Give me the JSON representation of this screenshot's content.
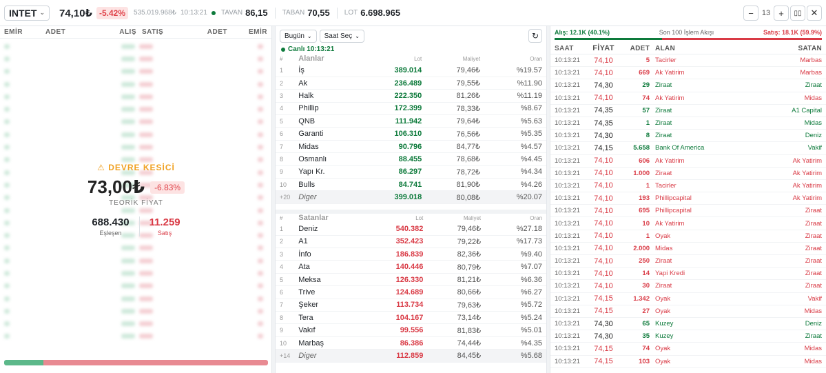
{
  "header": {
    "symbol": "INTET",
    "price": "74,10₺",
    "change": "-5.42%",
    "volume": "535.019.968₺",
    "time": "10:13:21",
    "tavan_label": "TAVAN",
    "tavan": "86,15",
    "taban_label": "TABAN",
    "taban": "70,55",
    "lot_label": "LOT",
    "lot": "6.698.965",
    "zoom": "13"
  },
  "orderbook": {
    "col_emir": "EMİR",
    "col_adet": "ADET",
    "col_alis": "ALIŞ",
    "col_satis": "SATIŞ",
    "col_adet2": "ADET",
    "col_emir2": "EMİR",
    "circuit_title": "DEVRE KESİCİ",
    "theoretical_price": "73,00₺",
    "theoretical_change": "-6.83%",
    "theoretical_label": "TEORİK FİYAT",
    "matched": "688.430",
    "matched_label": "Eşleşen",
    "sell": "11.259",
    "sell_label": "Satış",
    "colors": {
      "buy": "#0d7a3b",
      "sell": "#d93a45"
    }
  },
  "brokers": {
    "filter_day": "Bugün",
    "filter_time": "Saat Seç",
    "live": "Canlı 10:13:21",
    "col_lot": "Lot",
    "col_cost": "Maliyet",
    "col_ratio": "Oran",
    "buyers_title": "Alanlar",
    "buyers": [
      {
        "i": "1",
        "name": "İş",
        "lot": "389.014",
        "cost": "79,46₺",
        "ratio": "%19.57"
      },
      {
        "i": "2",
        "name": "Ak",
        "lot": "236.489",
        "cost": "79,55₺",
        "ratio": "%11.90"
      },
      {
        "i": "3",
        "name": "Halk",
        "lot": "222.350",
        "cost": "81,26₺",
        "ratio": "%11.19"
      },
      {
        "i": "4",
        "name": "Phillip",
        "lot": "172.399",
        "cost": "78,33₺",
        "ratio": "%8.67"
      },
      {
        "i": "5",
        "name": "QNB",
        "lot": "111.942",
        "cost": "79,64₺",
        "ratio": "%5.63"
      },
      {
        "i": "6",
        "name": "Garanti",
        "lot": "106.310",
        "cost": "76,56₺",
        "ratio": "%5.35"
      },
      {
        "i": "7",
        "name": "Midas",
        "lot": "90.796",
        "cost": "84,77₺",
        "ratio": "%4.57"
      },
      {
        "i": "8",
        "name": "Osmanlı",
        "lot": "88.455",
        "cost": "78,68₺",
        "ratio": "%4.45"
      },
      {
        "i": "9",
        "name": "Yapı Kr.",
        "lot": "86.297",
        "cost": "78,72₺",
        "ratio": "%4.34"
      },
      {
        "i": "10",
        "name": "Bulls",
        "lot": "84.741",
        "cost": "81,90₺",
        "ratio": "%4.26"
      }
    ],
    "buyers_other": {
      "i": "+20",
      "name": "Diger",
      "lot": "399.018",
      "cost": "80,08₺",
      "ratio": "%20.07"
    },
    "sellers_title": "Satanlar",
    "sellers": [
      {
        "i": "1",
        "name": "Deniz",
        "lot": "540.382",
        "cost": "79,46₺",
        "ratio": "%27.18"
      },
      {
        "i": "2",
        "name": "A1",
        "lot": "352.423",
        "cost": "79,22₺",
        "ratio": "%17.73"
      },
      {
        "i": "3",
        "name": "İnfo",
        "lot": "186.839",
        "cost": "82,36₺",
        "ratio": "%9.40"
      },
      {
        "i": "4",
        "name": "Ata",
        "lot": "140.446",
        "cost": "80,79₺",
        "ratio": "%7.07"
      },
      {
        "i": "5",
        "name": "Meksa",
        "lot": "126.330",
        "cost": "81,21₺",
        "ratio": "%6.36"
      },
      {
        "i": "6",
        "name": "Trive",
        "lot": "124.689",
        "cost": "80,66₺",
        "ratio": "%6.27"
      },
      {
        "i": "7",
        "name": "Şeker",
        "lot": "113.734",
        "cost": "79,63₺",
        "ratio": "%5.72"
      },
      {
        "i": "8",
        "name": "Tera",
        "lot": "104.167",
        "cost": "73,14₺",
        "ratio": "%5.24"
      },
      {
        "i": "9",
        "name": "Vakıf",
        "lot": "99.556",
        "cost": "81,83₺",
        "ratio": "%5.01"
      },
      {
        "i": "10",
        "name": "Marbaş",
        "lot": "86.386",
        "cost": "74,44₺",
        "ratio": "%4.35"
      }
    ],
    "sellers_other": {
      "i": "+14",
      "name": "Diger",
      "lot": "112.859",
      "cost": "84,45₺",
      "ratio": "%5.68"
    }
  },
  "flow": {
    "buy_text": "Alış: 12.1K (40.1%)",
    "title": "Son 100 İşlem Akışı",
    "sell_text": "Satış: 18.1K (59.9%)",
    "buy_ratio": 0.401,
    "col_time": "SAAT",
    "col_price": "FİYAT",
    "col_qty": "ADET",
    "col_buyer": "ALAN",
    "col_seller": "SATAN",
    "trades": [
      {
        "t": "10:13:21",
        "p": "74,10",
        "q": "5",
        "b": "Tacirler",
        "s": "Marbas",
        "pc": "red",
        "bc": "red",
        "sc": "red"
      },
      {
        "t": "10:13:21",
        "p": "74,10",
        "q": "669",
        "b": "Ak Yatirim",
        "s": "Marbas",
        "pc": "red",
        "bc": "red",
        "sc": "red"
      },
      {
        "t": "10:13:21",
        "p": "74,30",
        "q": "29",
        "b": "Ziraat",
        "s": "Ziraat",
        "pc": "dark",
        "bc": "green",
        "sc": "green"
      },
      {
        "t": "10:13:21",
        "p": "74,10",
        "q": "74",
        "b": "Ak Yatirim",
        "s": "Midas",
        "pc": "red",
        "bc": "red",
        "sc": "red"
      },
      {
        "t": "10:13:21",
        "p": "74,35",
        "q": "57",
        "b": "Ziraat",
        "s": "A1 Capital",
        "pc": "dark",
        "bc": "green",
        "sc": "green"
      },
      {
        "t": "10:13:21",
        "p": "74,35",
        "q": "1",
        "b": "Ziraat",
        "s": "Midas",
        "pc": "dark",
        "bc": "green",
        "sc": "green"
      },
      {
        "t": "10:13:21",
        "p": "74,30",
        "q": "8",
        "b": "Ziraat",
        "s": "Deniz",
        "pc": "dark",
        "bc": "green",
        "sc": "green"
      },
      {
        "t": "10:13:21",
        "p": "74,15",
        "q": "5.658",
        "b": "Bank Of America",
        "s": "Vakif",
        "pc": "dark",
        "bc": "green",
        "sc": "green"
      },
      {
        "t": "10:13:21",
        "p": "74,10",
        "q": "606",
        "b": "Ak Yatirim",
        "s": "Ak Yatirim",
        "pc": "red",
        "bc": "red",
        "sc": "red"
      },
      {
        "t": "10:13:21",
        "p": "74,10",
        "q": "1.000",
        "b": "Ziraat",
        "s": "Ak Yatirim",
        "pc": "red",
        "bc": "red",
        "sc": "red"
      },
      {
        "t": "10:13:21",
        "p": "74,10",
        "q": "1",
        "b": "Tacirler",
        "s": "Ak Yatirim",
        "pc": "red",
        "bc": "red",
        "sc": "red"
      },
      {
        "t": "10:13:21",
        "p": "74,10",
        "q": "193",
        "b": "Phillipcapital",
        "s": "Ak Yatirim",
        "pc": "red",
        "bc": "red",
        "sc": "red"
      },
      {
        "t": "10:13:21",
        "p": "74,10",
        "q": "695",
        "b": "Phillipcapital",
        "s": "Ziraat",
        "pc": "red",
        "bc": "red",
        "sc": "red"
      },
      {
        "t": "10:13:21",
        "p": "74,10",
        "q": "10",
        "b": "Ak Yatirim",
        "s": "Ziraat",
        "pc": "red",
        "bc": "red",
        "sc": "red"
      },
      {
        "t": "10:13:21",
        "p": "74,10",
        "q": "1",
        "b": "Oyak",
        "s": "Ziraat",
        "pc": "red",
        "bc": "red",
        "sc": "red"
      },
      {
        "t": "10:13:21",
        "p": "74,10",
        "q": "2.000",
        "b": "Midas",
        "s": "Ziraat",
        "pc": "red",
        "bc": "red",
        "sc": "red"
      },
      {
        "t": "10:13:21",
        "p": "74,10",
        "q": "250",
        "b": "Ziraat",
        "s": "Ziraat",
        "pc": "red",
        "bc": "red",
        "sc": "red"
      },
      {
        "t": "10:13:21",
        "p": "74,10",
        "q": "14",
        "b": "Yapi Kredi",
        "s": "Ziraat",
        "pc": "red",
        "bc": "red",
        "sc": "red"
      },
      {
        "t": "10:13:21",
        "p": "74,10",
        "q": "30",
        "b": "Ziraat",
        "s": "Ziraat",
        "pc": "red",
        "bc": "red",
        "sc": "red"
      },
      {
        "t": "10:13:21",
        "p": "74,15",
        "q": "1.342",
        "b": "Oyak",
        "s": "Vakif",
        "pc": "red",
        "bc": "red",
        "sc": "red"
      },
      {
        "t": "10:13:21",
        "p": "74,15",
        "q": "27",
        "b": "Oyak",
        "s": "Midas",
        "pc": "red",
        "bc": "red",
        "sc": "red"
      },
      {
        "t": "10:13:21",
        "p": "74,30",
        "q": "65",
        "b": "Kuzey",
        "s": "Deniz",
        "pc": "dark",
        "bc": "green",
        "sc": "green"
      },
      {
        "t": "10:13:21",
        "p": "74,30",
        "q": "35",
        "b": "Kuzey",
        "s": "Ziraat",
        "pc": "dark",
        "bc": "green",
        "sc": "green"
      },
      {
        "t": "10:13:21",
        "p": "74,15",
        "q": "74",
        "b": "Oyak",
        "s": "Midas",
        "pc": "red",
        "bc": "red",
        "sc": "red"
      },
      {
        "t": "10:13:21",
        "p": "74,15",
        "q": "103",
        "b": "Oyak",
        "s": "Midas",
        "pc": "red",
        "bc": "red",
        "sc": "red"
      }
    ]
  }
}
